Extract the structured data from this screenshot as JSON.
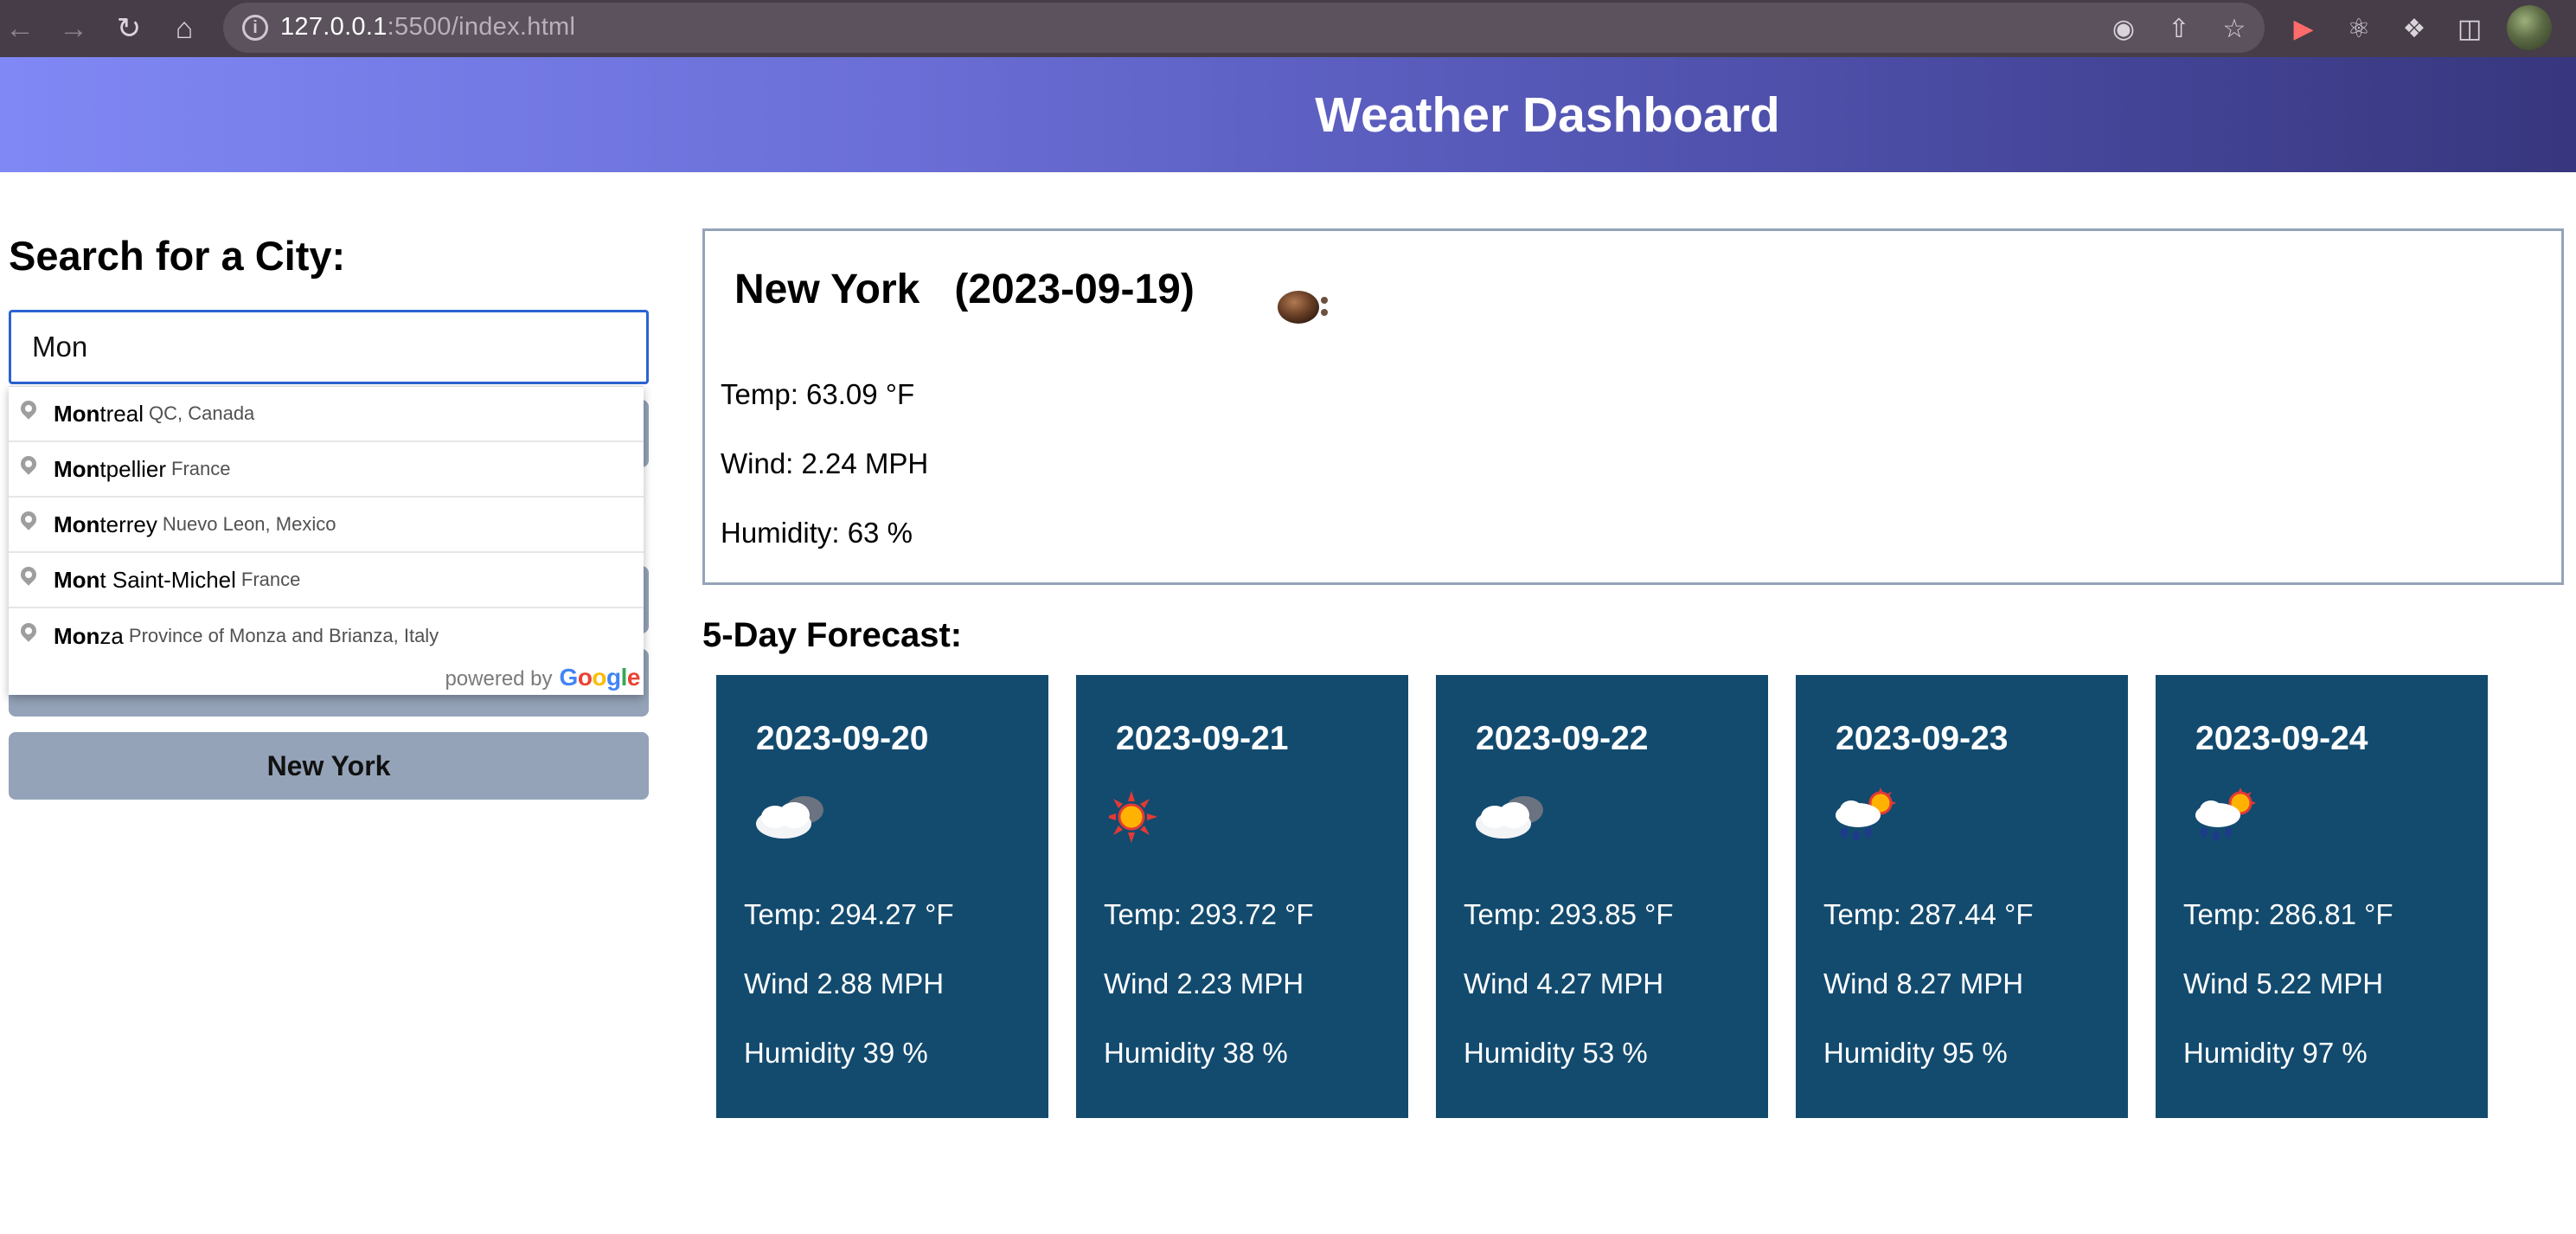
{
  "browser": {
    "url_host": "127.0.0.1",
    "url_rest": ":5500/index.html"
  },
  "header": {
    "title": "Weather Dashboard"
  },
  "search": {
    "title": "Search for a City:",
    "input_value": "Mon",
    "autocomplete": [
      {
        "match": "Mon",
        "rest": "treal",
        "secondary": "QC, Canada"
      },
      {
        "match": "Mon",
        "rest": "tpellier",
        "secondary": "France"
      },
      {
        "match": "Mon",
        "rest": "terrey",
        "secondary": "Nuevo Leon, Mexico"
      },
      {
        "match": "Mon",
        "rest": "t Saint-Michel",
        "secondary": "France"
      },
      {
        "match": "Mon",
        "rest": "za",
        "secondary": "Province of Monza and Brianza, Italy"
      }
    ],
    "powered_by": "powered by",
    "google": "Google",
    "history": [
      "New York"
    ]
  },
  "current": {
    "city": "New York",
    "date": "(2023-09-19)",
    "icon": "mist-icon",
    "temp": "Temp: 63.09 °F",
    "wind": "Wind: 2.24 MPH",
    "humidity": "Humidity: 63 %"
  },
  "forecast": {
    "title": "5-Day Forecast:",
    "days": [
      {
        "date": "2023-09-20",
        "icon": "cloudy-icon",
        "temp": "Temp: 294.27 °F",
        "wind": "Wind 2.88 MPH",
        "humidity": "Humidity 39 %"
      },
      {
        "date": "2023-09-21",
        "icon": "sun-icon",
        "temp": "Temp: 293.72 °F",
        "wind": "Wind 2.23 MPH",
        "humidity": "Humidity 38 %"
      },
      {
        "date": "2023-09-22",
        "icon": "cloudy-icon",
        "temp": "Temp: 293.85 °F",
        "wind": "Wind 4.27 MPH",
        "humidity": "Humidity 53 %"
      },
      {
        "date": "2023-09-23",
        "icon": "rain-sun-icon",
        "temp": "Temp: 287.44 °F",
        "wind": "Wind 8.27 MPH",
        "humidity": "Humidity 95 %"
      },
      {
        "date": "2023-09-24",
        "icon": "rain-sun-icon",
        "temp": "Temp: 286.81 °F",
        "wind": "Wind 5.22 MPH",
        "humidity": "Humidity 97 %"
      }
    ]
  },
  "colors": {
    "header_gradient_start": "#8088f5",
    "header_gradient_end": "#37367e",
    "forecast_card": "#134b6f",
    "history_button": "#94a3b8",
    "card_border": "#94a3b8"
  }
}
